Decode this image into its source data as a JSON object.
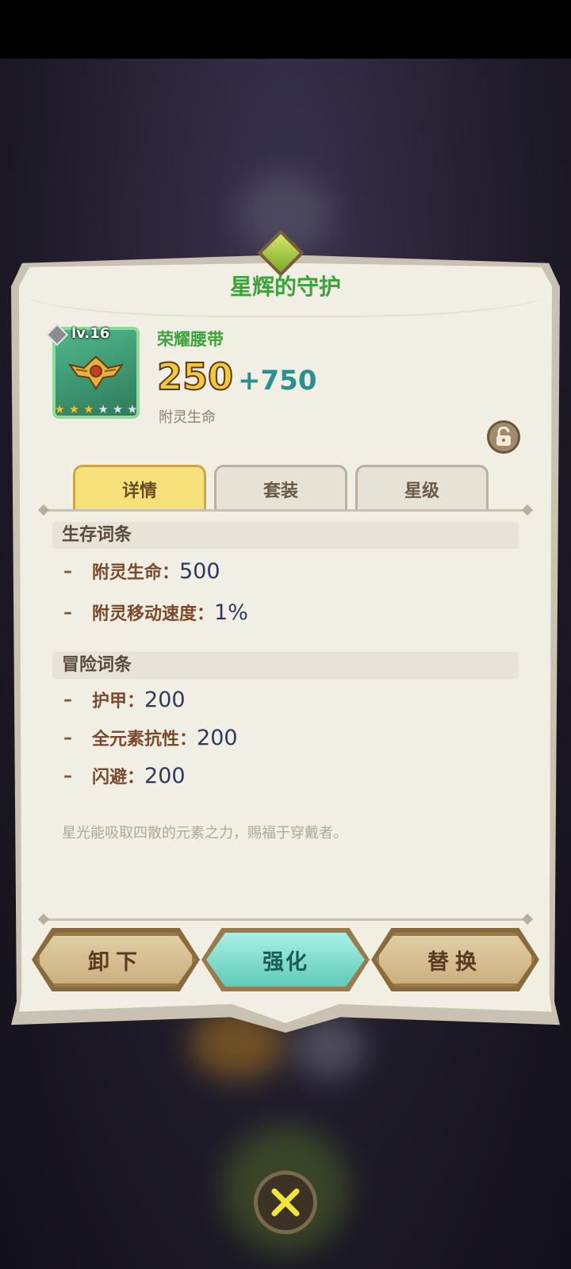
{
  "window": {
    "title": "星辉的守护"
  },
  "item": {
    "level": "lv.16",
    "name": "荣耀腰带",
    "stat_base": "250",
    "stat_bonus": "+750",
    "stat_label": "附灵生命",
    "stars_filled": 3,
    "stars_total": 6
  },
  "tabs": [
    {
      "label": "详情",
      "active": true
    },
    {
      "label": "套装",
      "active": false
    },
    {
      "label": "星级",
      "active": false
    }
  ],
  "sections": {
    "survival": {
      "title": "生存词条",
      "attrs": [
        {
          "dash": "–",
          "name": "附灵生命：",
          "value": "500"
        },
        {
          "dash": "–",
          "name": "附灵移动速度：",
          "value": "1%"
        }
      ]
    },
    "adventure": {
      "title": "冒险词条",
      "attrs": [
        {
          "dash": "–",
          "name": "护甲：",
          "value": "200"
        },
        {
          "dash": "–",
          "name": "全元素抗性：",
          "value": "200"
        },
        {
          "dash": "–",
          "name": "闪避：",
          "value": "200"
        }
      ]
    }
  },
  "description": "星光能吸取四散的元素之力，赐福于穿戴者。",
  "buttons": {
    "unequip": "卸下",
    "enhance": "强化",
    "replace": "替换"
  },
  "icons": {
    "lock": "lock-icon",
    "close": "close-icon",
    "item": "belt-icon"
  }
}
